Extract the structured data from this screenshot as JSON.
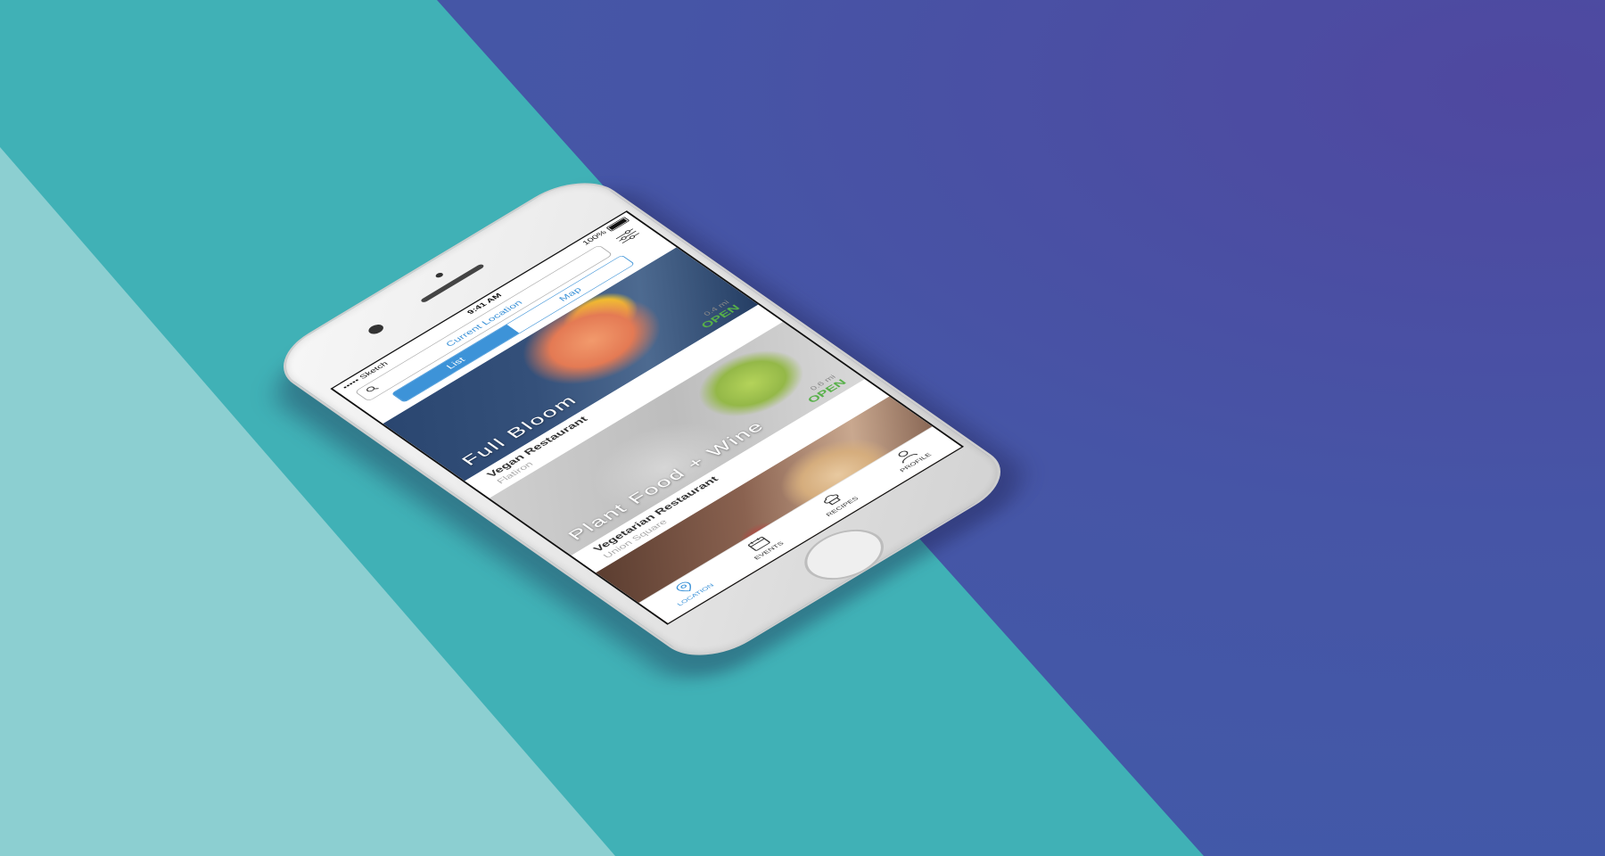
{
  "status_bar": {
    "carrier": "••••• Sketch",
    "time": "9:41 AM",
    "battery": "100%"
  },
  "search": {
    "placeholder": "Current Location"
  },
  "view_toggle": {
    "list_label": "List",
    "map_label": "Map",
    "selected": "List"
  },
  "restaurants": [
    {
      "name": "Full Bloom",
      "type": "Vegan Restaurant",
      "area": "Flatiron",
      "distance": "0.4 mi",
      "status": "OPEN"
    },
    {
      "name": "Plant Food + Wine",
      "type": "Vegetarian Restaurant",
      "area": "Union Square",
      "distance": "0.6 mi",
      "status": "OPEN"
    }
  ],
  "tabs": [
    {
      "label": "LOCATION",
      "icon": "location-pin-icon",
      "active": true
    },
    {
      "label": "EVENTS",
      "icon": "calendar-icon",
      "active": false
    },
    {
      "label": "RECIPES",
      "icon": "chef-hat-icon",
      "active": false
    },
    {
      "label": "PROFILE",
      "icon": "user-icon",
      "active": false
    }
  ],
  "colors": {
    "accent": "#3d93d8",
    "open_status": "#57b049",
    "background_teal": "#40b1b6",
    "background_blue": "#4655a6",
    "background_light": "#8ccfd1"
  }
}
